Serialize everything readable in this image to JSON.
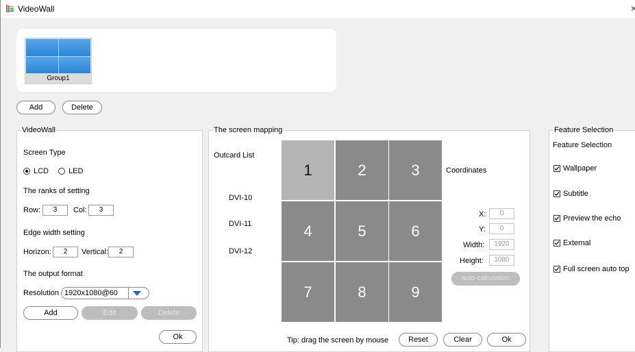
{
  "window": {
    "title": "VideoWall",
    "close_glyph": "×"
  },
  "groups": [
    {
      "name": "Group1"
    }
  ],
  "group_buttons": {
    "add": "Add",
    "delete": "Delete"
  },
  "videowall_panel": {
    "legend": "VideoWall",
    "screen_type_label": "Screen Type",
    "options": {
      "lcd": "LCD",
      "led": "LED"
    },
    "selected_type": "LCD",
    "ranks_label": "The ranks of setting",
    "row_label": "Row:",
    "row_value": "3",
    "col_label": "Col:",
    "col_value": "3",
    "edge_label": "Edge width setting",
    "horizon_label": "Horizon:",
    "horizon_value": "2",
    "vertical_label": "Vertical:",
    "vertical_value": "2",
    "output_label": "The output format",
    "resolution_label": "Resolution",
    "resolution_value": "1920x1080@60",
    "add": "Add",
    "edit": "Edit",
    "delete": "Delete",
    "ok": "Ok"
  },
  "mapping_panel": {
    "legend": "The screen mapping",
    "outcard_label": "Outcard List",
    "outcards": [
      "DVI-10",
      "DVI-11",
      "DVI-12"
    ],
    "cells": [
      "1",
      "2",
      "3",
      "4",
      "5",
      "6",
      "7",
      "8",
      "9"
    ],
    "selected_cell": "1",
    "coordinates_label": "Coordinates",
    "x_label": "X:",
    "x_value": "0",
    "y_label": "Y:",
    "y_value": "0",
    "width_label": "Width:",
    "width_value": "1920",
    "height_label": "Height:",
    "height_value": "1080",
    "auto_calc": "auto-calculation",
    "tip": "Tip: drag the screen by mouse",
    "reset": "Reset",
    "clear": "Clear",
    "ok": "Ok"
  },
  "feature_panel": {
    "legend": "Feature Selection",
    "heading": "Feature Selection",
    "items": [
      {
        "label": "Wallpaper",
        "checked": true
      },
      {
        "label": "Subtitle",
        "checked": true
      },
      {
        "label": "Preview the echo",
        "checked": true
      },
      {
        "label": "External",
        "checked": true
      },
      {
        "label": "Full screen auto top",
        "checked": true
      }
    ]
  },
  "colors": {
    "accent": "#1e63d6",
    "tile_blue": "#2b86d8",
    "cell_gray": "#8a8a8a",
    "cell_selected": "#b5b5b5"
  },
  "icons": {
    "app": "videowall-app-icon",
    "dropdown": "triangle-down-icon",
    "check": "checkmark-icon"
  }
}
